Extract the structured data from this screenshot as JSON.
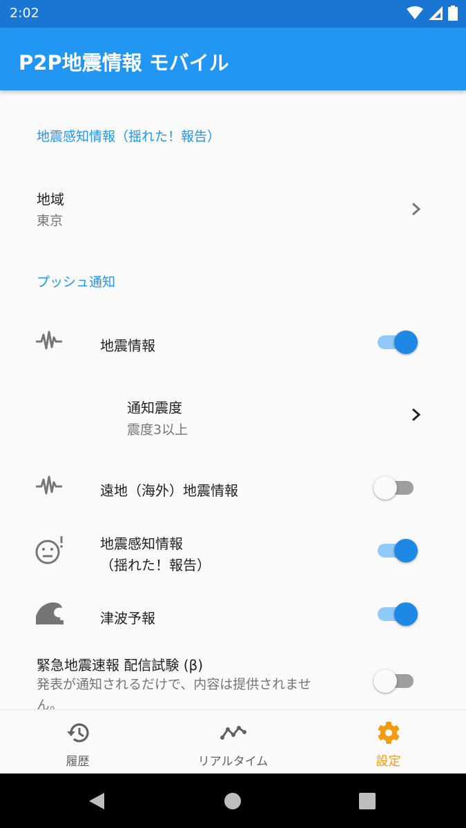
{
  "status_bar": {
    "time": "2:02"
  },
  "app_bar": {
    "title": "P2P地震情報 モバイル"
  },
  "sections": {
    "detection": "地震感知情報（揺れた！報告）",
    "push": "プッシュ通知"
  },
  "region": {
    "title": "地域",
    "value": "東京"
  },
  "push_items": {
    "quake_info": {
      "label": "地震情報",
      "enabled": true
    },
    "notify_intensity": {
      "title": "通知震度",
      "value": "震度3以上"
    },
    "distant_quake": {
      "label": "遠地（海外）地震情報",
      "enabled": false
    },
    "detection_report": {
      "line1": "地震感知情報",
      "line2": "（揺れた！報告）",
      "enabled": true
    },
    "tsunami": {
      "label": "津波予報",
      "enabled": true
    },
    "eew_test": {
      "title": "緊急地震速報 配信試験 (β)",
      "desc_line1": "発表が通知されるだけで、内容は提供されませ",
      "desc_line2": "ん。",
      "enabled": false
    }
  },
  "bottom_nav": {
    "history": "履歴",
    "realtime": "リアルタイム",
    "settings": "設定",
    "active": "settings"
  },
  "colors": {
    "status_bar": "#1976d2",
    "app_bar": "#2196f3",
    "accent": "#2196f3",
    "switch_on": "#1e88e5",
    "active_nav": "#f39c12"
  },
  "icons": {
    "wifi": "wifi-icon",
    "signal": "cell-signal-icon",
    "battery": "battery-icon",
    "seismic": "seismic-wave-icon",
    "shaken_face": "shaken-face-icon",
    "wave": "tsunami-wave-icon",
    "history": "history-icon",
    "realtime": "realtime-line-icon",
    "settings": "gear-icon"
  }
}
